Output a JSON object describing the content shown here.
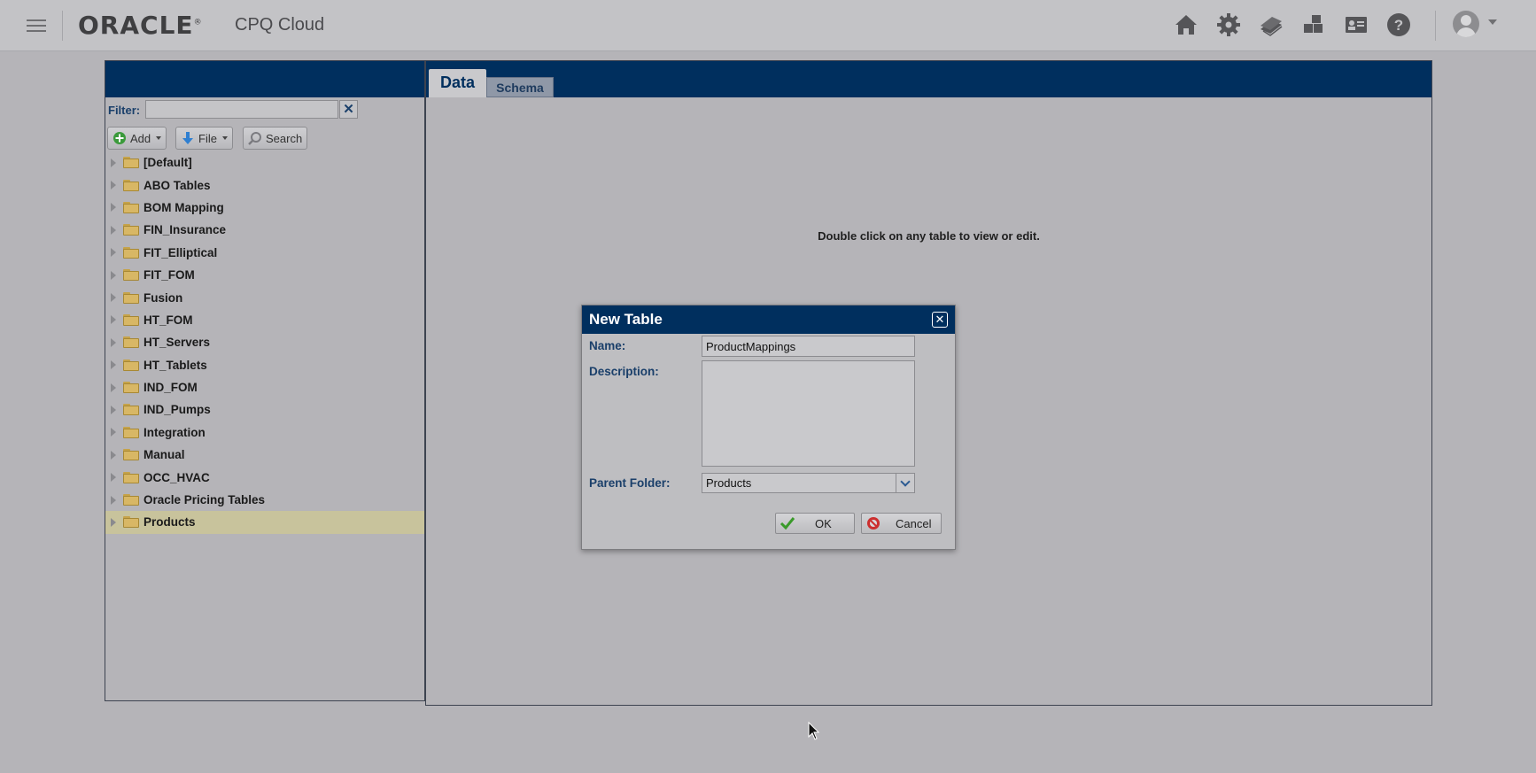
{
  "header": {
    "logo_text": "ORACLE",
    "logo_reg": "®",
    "product_name": "CPQ Cloud",
    "icons": [
      "home-icon",
      "gear-icon",
      "money-icon",
      "blocks-icon",
      "id-card-icon",
      "help-icon"
    ]
  },
  "left_panel": {
    "filter_label": "Filter:",
    "filter_value": "",
    "filter_clear": "✕",
    "toolbar": {
      "add_label": "Add",
      "file_label": "File",
      "search_label": "Search"
    },
    "tree": [
      {
        "label": "[Default]"
      },
      {
        "label": "ABO Tables"
      },
      {
        "label": "BOM Mapping"
      },
      {
        "label": "FIN_Insurance"
      },
      {
        "label": "FIT_Elliptical"
      },
      {
        "label": "FIT_FOM"
      },
      {
        "label": "Fusion"
      },
      {
        "label": "HT_FOM"
      },
      {
        "label": "HT_Servers"
      },
      {
        "label": "HT_Tablets"
      },
      {
        "label": "IND_FOM"
      },
      {
        "label": "IND_Pumps"
      },
      {
        "label": "Integration"
      },
      {
        "label": "Manual"
      },
      {
        "label": "OCC_HVAC"
      },
      {
        "label": "Oracle Pricing Tables"
      },
      {
        "label": "Products",
        "selected": true
      }
    ]
  },
  "right_panel": {
    "tabs": [
      {
        "label": "Data",
        "active": true
      },
      {
        "label": "Schema",
        "active": false
      }
    ],
    "hint": "Double click on any table to view or edit."
  },
  "dialog": {
    "title": "New Table",
    "close": "✕",
    "name_label": "Name:",
    "name_value": "ProductMappings",
    "description_label": "Description:",
    "description_value": "",
    "parent_label": "Parent Folder:",
    "parent_value": "Products",
    "ok_label": "OK",
    "cancel_label": "Cancel"
  },
  "colors": {
    "navy": "#002f5e",
    "selected_row": "#c8c39c",
    "background": "#b5b4b8"
  }
}
